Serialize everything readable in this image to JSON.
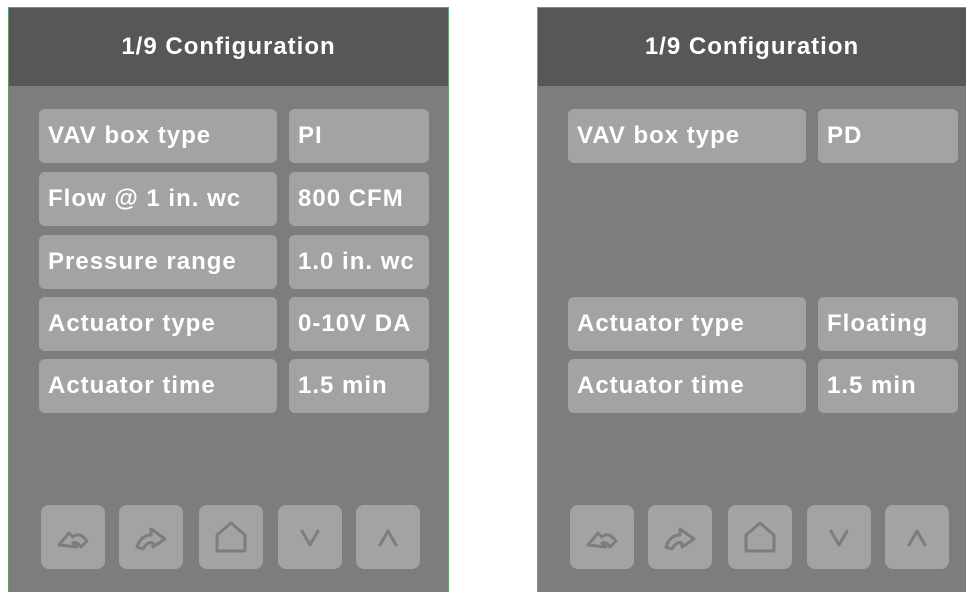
{
  "panels": [
    {
      "title": "1/9 Configuration",
      "rows": [
        {
          "label": "VAV box type",
          "value": "PI"
        },
        {
          "label": "Flow @ 1 in. wc",
          "value": "800 CFM"
        },
        {
          "label": "Pressure range",
          "value": "1.0 in. wc"
        },
        {
          "label": "Actuator type",
          "value": "0-10V DA"
        },
        {
          "label": "Actuator time",
          "value": "1.5 min"
        }
      ]
    },
    {
      "title": "1/9 Configuration",
      "rows": [
        {
          "label": "VAV box type",
          "value": "PD"
        },
        {
          "label": "Actuator type",
          "value": "Floating"
        },
        {
          "label": "Actuator time",
          "value": "1.5 min"
        }
      ]
    }
  ],
  "buttons": [
    "undo-icon",
    "redo-icon",
    "home-icon",
    "chevron-down-icon",
    "chevron-up-icon"
  ],
  "colors": {
    "panel": "#7d7d7d",
    "header": "#575757",
    "cell": "#a3a3a3",
    "text": "#ffffff"
  }
}
